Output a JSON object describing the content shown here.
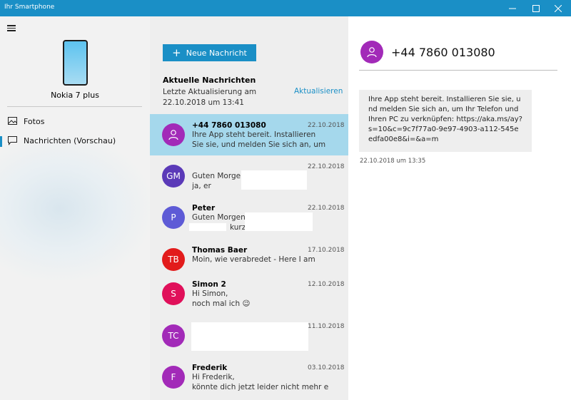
{
  "window": {
    "title": "Ihr Smartphone"
  },
  "sidebar": {
    "device_name": "Nokia 7 plus",
    "items": [
      {
        "label": "Fotos",
        "icon": "photo-icon"
      },
      {
        "label": "Nachrichten (Vorschau)",
        "icon": "message-icon",
        "selected": true
      }
    ]
  },
  "messages": {
    "new_button_label": "Neue Nachricht",
    "section_title": "Aktuelle Nachrichten",
    "last_update": "Letzte Aktualisierung am 22.10.2018 um 13:41",
    "refresh_label": "Aktualisieren",
    "conversations": [
      {
        "name": "+44 7860 013080",
        "date": "22.10.2018",
        "line1": "Ihre App steht bereit. Installieren",
        "line2": "Sie sie, und melden Sie sich an, um",
        "avatar_color": "#a22ab8",
        "selected": true
      },
      {
        "name": "",
        "initials": "GM",
        "date": "22.10.2018",
        "line1": "Guten Morgen",
        "line2": "ja, er",
        "avatar_color": "#5b3ab8"
      },
      {
        "name": "Peter",
        "initials": "P",
        "date": "22.10.2018",
        "line1": "Guten Morgen",
        "line2": "kurz",
        "avatar_color": "#5e5bd6"
      },
      {
        "name": "Thomas Baer",
        "initials": "TB",
        "date": "17.10.2018",
        "line1": "Moin, wie verabredet - Here I am",
        "line2": "",
        "avatar_color": "#e21b1b"
      },
      {
        "name": "Simon 2",
        "initials": "S",
        "date": "12.10.2018",
        "line1": "Hi Simon,",
        "line2": "noch mal ich 😉",
        "avatar_color": "#e0105a"
      },
      {
        "name": "",
        "initials": "TC",
        "date": "11.10.2018",
        "line1": "",
        "line2": "",
        "avatar_color": "#a22ab8"
      },
      {
        "name": "Frederik",
        "initials": "F",
        "date": "03.10.2018",
        "line1": "Hi Frederik,",
        "line2": "könnte dich jetzt leider nicht mehr e",
        "avatar_color": "#a22ab8"
      }
    ]
  },
  "conversation": {
    "contact": "+44 7860 013080",
    "message_text": "Ihre App steht bereit. Installieren Sie sie, und melden Sie sich an, um Ihr Telefon und Ihren PC zu verknüpfen: https://aka.ms/ay?s=10&c=9c7f77a0-9e97-4903-a112-545eedfa00e8&i=&a=m",
    "message_time": "22.10.2018 um 13:35"
  },
  "colors": {
    "accent": "#1a8fc6",
    "selected_row": "#a5d8ec"
  }
}
